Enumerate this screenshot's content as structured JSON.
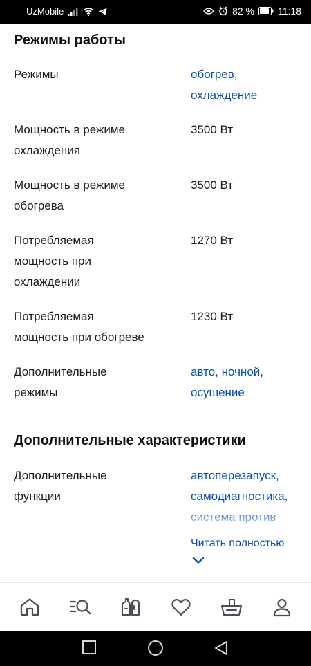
{
  "status_bar": {
    "carrier": "UzMobile",
    "battery": "82 %",
    "time": "11:18"
  },
  "sections": {
    "modes": {
      "title": "Режимы работы",
      "rows": [
        {
          "label": "Режимы",
          "value_line1": "обогрев,",
          "value_line2": "охлаждение"
        },
        {
          "label_line1": "Мощность в режиме",
          "label_line2": "охлаждения",
          "value": "3500 Вт"
        },
        {
          "label_line1": "Мощность в режиме",
          "label_line2": "обогрева",
          "value": "3500 Вт"
        },
        {
          "label_line1": "Потребляемая",
          "label_line2": "мощность при",
          "label_line3": "охлаждении",
          "value": "1270 Вт"
        },
        {
          "label_line1": "Потребляемая",
          "label_line2": "мощность при обогреве",
          "value": "1230 Вт"
        },
        {
          "label_line1": "Дополнительные",
          "label_line2": "режимы",
          "value_line1": "авто, ночной,",
          "value_line2": "осушение"
        }
      ]
    },
    "extra": {
      "title": "Дополнительные характеристики",
      "rows": [
        {
          "label_line1": "Дополнительные",
          "label_line2": "функции",
          "value_line1": "автоперезапуск,",
          "value_line2": "самодиагностика,",
          "value_line3": "система против"
        }
      ],
      "read_more": "Читать полностью"
    }
  },
  "bottom_nav": {
    "items": [
      "home-icon",
      "catalog-search-icon",
      "compare-icon",
      "favorites-heart-icon",
      "cart-basket-icon",
      "profile-icon"
    ]
  },
  "colors": {
    "link": "#0a4fa8",
    "text": "#1a1a1a",
    "icon": "#4a4f57"
  }
}
